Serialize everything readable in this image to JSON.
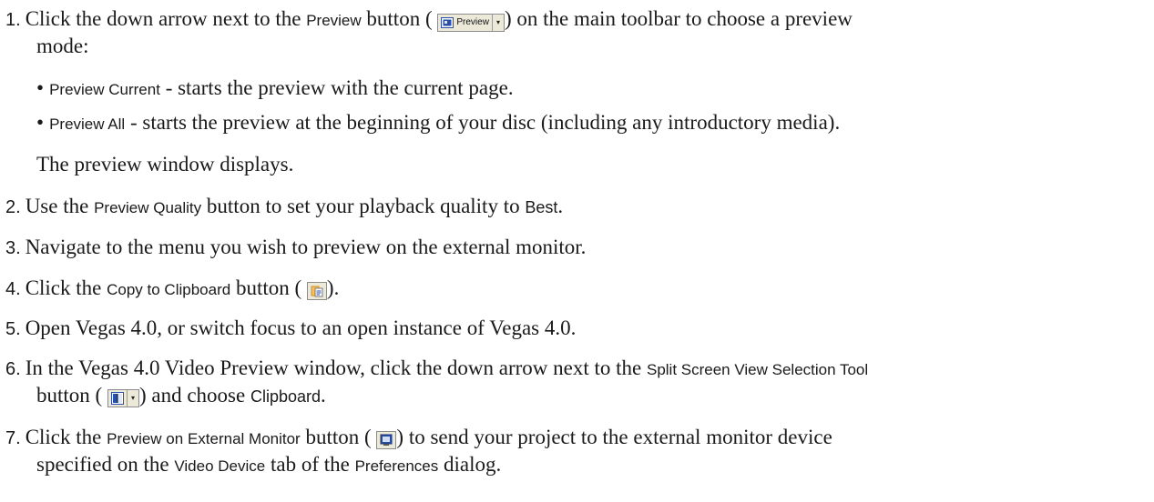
{
  "steps": [
    {
      "number": "1.",
      "t1": "Click the down arrow next to the ",
      "ui1": "Preview",
      "t2": " button ( ",
      "t3": ") on the main toolbar to choose a preview",
      "t4": "mode:"
    },
    {
      "number": "2.",
      "t1": "Use the ",
      "ui1": "Preview Quality",
      "t2": " button to set your playback quality to ",
      "ui2": "Best",
      "t3": "."
    },
    {
      "number": "3.",
      "t1": "Navigate to the menu you wish to preview on the external monitor."
    },
    {
      "number": "4.",
      "t1": "Click the ",
      "ui1": "Copy to Clipboard",
      "t2": " button ( ",
      "t3": ")."
    },
    {
      "number": "5.",
      "t1": "Open Vegas 4.0, or switch focus to an open instance of Vegas 4.0."
    },
    {
      "number": "6.",
      "t1": "In the Vegas 4.0 Video Preview window, click the down arrow next to the ",
      "ui1": "Split Screen View Selection Tool",
      "t2": "button ( ",
      "t3": ") and choose ",
      "ui2": "Clipboard",
      "t4": "."
    },
    {
      "number": "7.",
      "t1": "Click the ",
      "ui1": "Preview on External Monitor",
      "t2": " button ( ",
      "t3": ") to send your project to the external monitor device",
      "t4": "specified on the ",
      "ui2": "Video Device",
      "t5": " tab of the ",
      "ui3": "Preferences",
      "t6": " dialog."
    }
  ],
  "bullets": [
    {
      "ui": "Preview Current",
      "text": " - starts the preview with the current page."
    },
    {
      "ui": "Preview All",
      "text": " - starts the preview at the beginning of your disc (including any introductory media)."
    }
  ],
  "bullet_glyph": "•",
  "after_bullets": "The preview window displays.",
  "preview_button": {
    "label": "Preview",
    "icon": "preview-frame-icon",
    "dropdown": "▾"
  },
  "copy_button": {
    "icon": "clipboard-copy-icon"
  },
  "split_button": {
    "icon": "split-screen-icon",
    "dropdown": "▾"
  },
  "monitor_button": {
    "icon": "external-monitor-icon"
  },
  "colors": {
    "text": "#1a1a1a",
    "button_face": "#ece9d8",
    "icon_blue": "#2a4fa8",
    "clipboard_orange": "#d98a1c"
  }
}
